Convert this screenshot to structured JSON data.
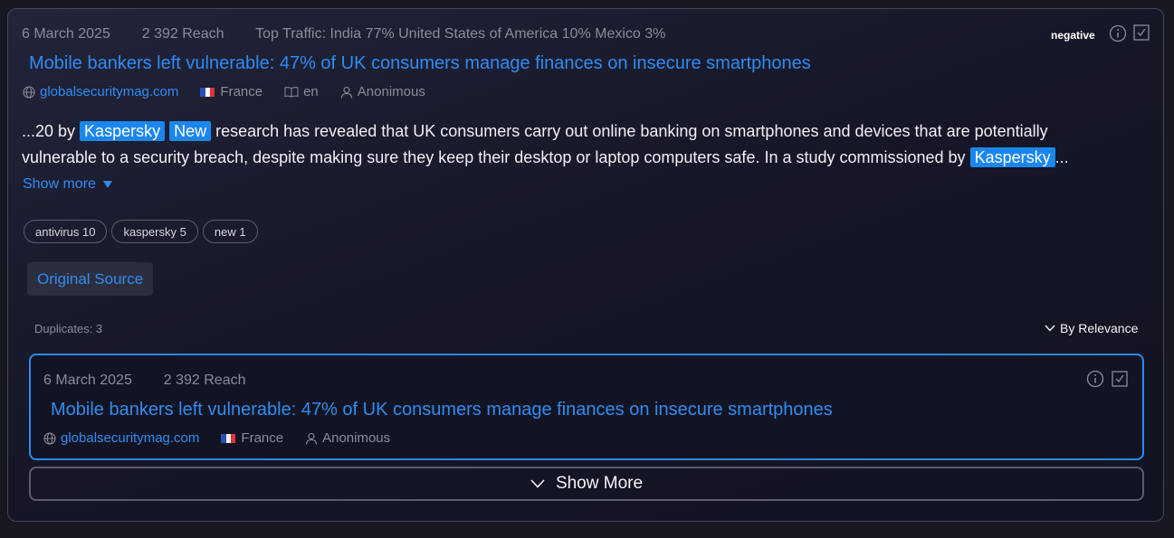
{
  "article": {
    "date": "6 March 2025",
    "reach": "2 392 Reach",
    "top_traffic": "Top Traffic: India 77% United States of America 10% Mexico 3%",
    "sentiment": "negative",
    "title": "Mobile bankers left vulnerable: 47% of UK consumers manage finances on insecure smartphones",
    "domain": "globalsecuritymag.com",
    "country": "France",
    "language": "en",
    "author": "Anonimous",
    "snippet": {
      "prefix": "...20 by ",
      "hl1": "Kaspersky",
      "hl2": "New",
      "middle": " research has revealed that UK consumers carry out online banking on smartphones and devices that are potentially vulnerable to a security breach, despite making sure they keep their desktop or laptop computers safe. In a study commissioned by ",
      "hl3": "Kaspersky",
      "suffix": "..."
    },
    "show_more": "Show more",
    "tags": [
      "antivirus 10",
      "kaspersky 5",
      "new 1"
    ],
    "original_source": "Original Source"
  },
  "duplicates": {
    "label": "Duplicates: 3",
    "sort": "By Relevance",
    "items": [
      {
        "date": "6 March 2025",
        "reach": "2 392 Reach",
        "title": "Mobile bankers left vulnerable: 47% of UK consumers manage finances on insecure smartphones",
        "domain": "globalsecuritymag.com",
        "country": "France",
        "author": "Anonimous"
      }
    ],
    "show_more": "Show More"
  },
  "colors": {
    "accent": "#2f8cf2",
    "highlight": "#1a86f2",
    "card_bg": "#161727",
    "border": "#44465a"
  },
  "icons": [
    "globe-icon",
    "flag-france-icon",
    "book-icon",
    "user-icon",
    "info-icon",
    "checkbox-icon",
    "chevron-down-icon",
    "triangle-down-icon"
  ]
}
